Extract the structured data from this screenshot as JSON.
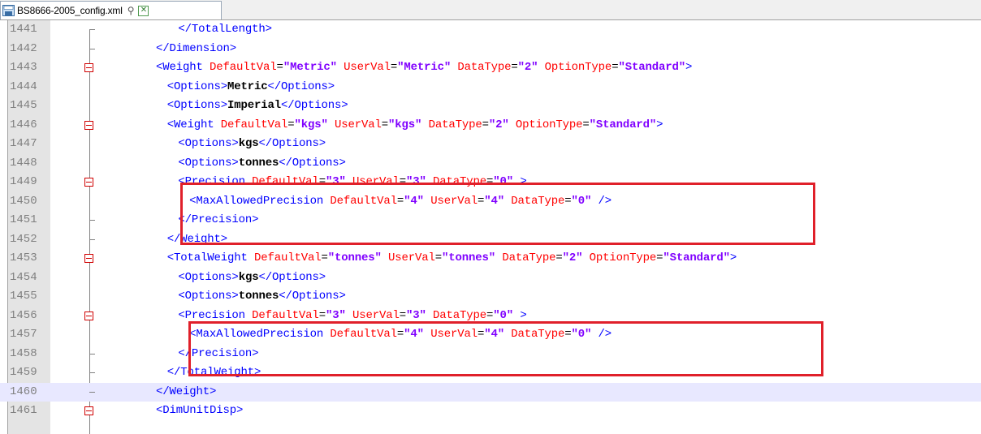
{
  "tab": {
    "filename": "BS8666-2005_config.xml",
    "pin_glyph": "⚲",
    "close_glyph": "✕",
    "icons": [
      "file-icon",
      "pin-icon",
      "close-icon"
    ]
  },
  "colors": {
    "tag": "#0000ff",
    "attribute_name": "#ff0000",
    "attribute_value": "#8000ff",
    "text": "#000000",
    "line_number": "#808080",
    "highlight_box": "#e0202a",
    "current_line": "#e8e8ff"
  },
  "lines": [
    {
      "num": "1441",
      "fold": "tick",
      "indent": 6,
      "segs": [
        {
          "t": "tb",
          "v": "</"
        },
        {
          "t": "tn",
          "v": "TotalLength"
        },
        {
          "t": "tb",
          "v": ">"
        }
      ]
    },
    {
      "num": "1442",
      "fold": "tick",
      "indent": 4,
      "segs": [
        {
          "t": "tb",
          "v": "</"
        },
        {
          "t": "tn",
          "v": "Dimension"
        },
        {
          "t": "tb",
          "v": ">"
        }
      ]
    },
    {
      "num": "1443",
      "fold": "box",
      "indent": 4,
      "segs": [
        {
          "t": "tb",
          "v": "<"
        },
        {
          "t": "tn",
          "v": "Weight"
        },
        {
          "t": "an",
          "v": " DefaultVal"
        },
        {
          "t": "eq",
          "v": "="
        },
        {
          "t": "av",
          "v": "\"Metric\""
        },
        {
          "t": "an",
          "v": " UserVal"
        },
        {
          "t": "eq",
          "v": "="
        },
        {
          "t": "av",
          "v": "\"Metric\""
        },
        {
          "t": "an",
          "v": " DataType"
        },
        {
          "t": "eq",
          "v": "="
        },
        {
          "t": "av",
          "v": "\"2\""
        },
        {
          "t": "an",
          "v": " OptionType"
        },
        {
          "t": "eq",
          "v": "="
        },
        {
          "t": "av",
          "v": "\"Standard\""
        },
        {
          "t": "tb",
          "v": ">"
        }
      ]
    },
    {
      "num": "1444",
      "fold": "none",
      "indent": 5,
      "segs": [
        {
          "t": "tb",
          "v": "<"
        },
        {
          "t": "tn",
          "v": "Options"
        },
        {
          "t": "tb",
          "v": ">"
        },
        {
          "t": "tx",
          "v": "Metric"
        },
        {
          "t": "tb",
          "v": "</"
        },
        {
          "t": "tn",
          "v": "Options"
        },
        {
          "t": "tb",
          "v": ">"
        }
      ]
    },
    {
      "num": "1445",
      "fold": "none",
      "indent": 5,
      "segs": [
        {
          "t": "tb",
          "v": "<"
        },
        {
          "t": "tn",
          "v": "Options"
        },
        {
          "t": "tb",
          "v": ">"
        },
        {
          "t": "tx",
          "v": "Imperial"
        },
        {
          "t": "tb",
          "v": "</"
        },
        {
          "t": "tn",
          "v": "Options"
        },
        {
          "t": "tb",
          "v": ">"
        }
      ]
    },
    {
      "num": "1446",
      "fold": "box",
      "indent": 5,
      "segs": [
        {
          "t": "tb",
          "v": "<"
        },
        {
          "t": "tn",
          "v": "Weight"
        },
        {
          "t": "an",
          "v": " DefaultVal"
        },
        {
          "t": "eq",
          "v": "="
        },
        {
          "t": "av",
          "v": "\"kgs\""
        },
        {
          "t": "an",
          "v": " UserVal"
        },
        {
          "t": "eq",
          "v": "="
        },
        {
          "t": "av",
          "v": "\"kgs\""
        },
        {
          "t": "an",
          "v": " DataType"
        },
        {
          "t": "eq",
          "v": "="
        },
        {
          "t": "av",
          "v": "\"2\""
        },
        {
          "t": "an",
          "v": " OptionType"
        },
        {
          "t": "eq",
          "v": "="
        },
        {
          "t": "av",
          "v": "\"Standard\""
        },
        {
          "t": "tb",
          "v": ">"
        }
      ]
    },
    {
      "num": "1447",
      "fold": "none",
      "indent": 6,
      "segs": [
        {
          "t": "tb",
          "v": "<"
        },
        {
          "t": "tn",
          "v": "Options"
        },
        {
          "t": "tb",
          "v": ">"
        },
        {
          "t": "tx",
          "v": "kgs"
        },
        {
          "t": "tb",
          "v": "</"
        },
        {
          "t": "tn",
          "v": "Options"
        },
        {
          "t": "tb",
          "v": ">"
        }
      ]
    },
    {
      "num": "1448",
      "fold": "none",
      "indent": 6,
      "segs": [
        {
          "t": "tb",
          "v": "<"
        },
        {
          "t": "tn",
          "v": "Options"
        },
        {
          "t": "tb",
          "v": ">"
        },
        {
          "t": "tx",
          "v": "tonnes"
        },
        {
          "t": "tb",
          "v": "</"
        },
        {
          "t": "tn",
          "v": "Options"
        },
        {
          "t": "tb",
          "v": ">"
        }
      ]
    },
    {
      "num": "1449",
      "fold": "box",
      "indent": 6,
      "segs": [
        {
          "t": "tb",
          "v": "<"
        },
        {
          "t": "tn",
          "v": "Precision"
        },
        {
          "t": "an",
          "v": " DefaultVal"
        },
        {
          "t": "eq",
          "v": "="
        },
        {
          "t": "av",
          "v": "\"3\""
        },
        {
          "t": "an",
          "v": " UserVal"
        },
        {
          "t": "eq",
          "v": "="
        },
        {
          "t": "av",
          "v": "\"3\""
        },
        {
          "t": "an",
          "v": " DataType"
        },
        {
          "t": "eq",
          "v": "="
        },
        {
          "t": "av",
          "v": "\"0\""
        },
        {
          "t": "tb",
          "v": " >"
        }
      ]
    },
    {
      "num": "1450",
      "fold": "none",
      "indent": 7,
      "segs": [
        {
          "t": "tb",
          "v": "<"
        },
        {
          "t": "tn",
          "v": "MaxAllowedPrecision"
        },
        {
          "t": "an",
          "v": " DefaultVal"
        },
        {
          "t": "eq",
          "v": "="
        },
        {
          "t": "av",
          "v": "\"4\""
        },
        {
          "t": "an",
          "v": " UserVal"
        },
        {
          "t": "eq",
          "v": "="
        },
        {
          "t": "av",
          "v": "\"4\""
        },
        {
          "t": "an",
          "v": " DataType"
        },
        {
          "t": "eq",
          "v": "="
        },
        {
          "t": "av",
          "v": "\"0\""
        },
        {
          "t": "tb",
          "v": " />"
        }
      ]
    },
    {
      "num": "1451",
      "fold": "tick",
      "indent": 6,
      "segs": [
        {
          "t": "tb",
          "v": "</"
        },
        {
          "t": "tn",
          "v": "Precision"
        },
        {
          "t": "tb",
          "v": ">"
        }
      ]
    },
    {
      "num": "1452",
      "fold": "tick",
      "indent": 5,
      "segs": [
        {
          "t": "tb",
          "v": "</"
        },
        {
          "t": "tn",
          "v": "Weight"
        },
        {
          "t": "tb",
          "v": ">"
        }
      ]
    },
    {
      "num": "1453",
      "fold": "box",
      "indent": 5,
      "segs": [
        {
          "t": "tb",
          "v": "<"
        },
        {
          "t": "tn",
          "v": "TotalWeight"
        },
        {
          "t": "an",
          "v": " DefaultVal"
        },
        {
          "t": "eq",
          "v": "="
        },
        {
          "t": "av",
          "v": "\"tonnes\""
        },
        {
          "t": "an",
          "v": " UserVal"
        },
        {
          "t": "eq",
          "v": "="
        },
        {
          "t": "av",
          "v": "\"tonnes\""
        },
        {
          "t": "an",
          "v": " DataType"
        },
        {
          "t": "eq",
          "v": "="
        },
        {
          "t": "av",
          "v": "\"2\""
        },
        {
          "t": "an",
          "v": " OptionType"
        },
        {
          "t": "eq",
          "v": "="
        },
        {
          "t": "av",
          "v": "\"Standard\""
        },
        {
          "t": "tb",
          "v": ">"
        }
      ]
    },
    {
      "num": "1454",
      "fold": "none",
      "indent": 6,
      "segs": [
        {
          "t": "tb",
          "v": "<"
        },
        {
          "t": "tn",
          "v": "Options"
        },
        {
          "t": "tb",
          "v": ">"
        },
        {
          "t": "tx",
          "v": "kgs"
        },
        {
          "t": "tb",
          "v": "</"
        },
        {
          "t": "tn",
          "v": "Options"
        },
        {
          "t": "tb",
          "v": ">"
        }
      ]
    },
    {
      "num": "1455",
      "fold": "none",
      "indent": 6,
      "segs": [
        {
          "t": "tb",
          "v": "<"
        },
        {
          "t": "tn",
          "v": "Options"
        },
        {
          "t": "tb",
          "v": ">"
        },
        {
          "t": "tx",
          "v": "tonnes"
        },
        {
          "t": "tb",
          "v": "</"
        },
        {
          "t": "tn",
          "v": "Options"
        },
        {
          "t": "tb",
          "v": ">"
        }
      ]
    },
    {
      "num": "1456",
      "fold": "box",
      "indent": 6,
      "segs": [
        {
          "t": "tb",
          "v": "<"
        },
        {
          "t": "tn",
          "v": "Precision"
        },
        {
          "t": "an",
          "v": " DefaultVal"
        },
        {
          "t": "eq",
          "v": "="
        },
        {
          "t": "av",
          "v": "\"3\""
        },
        {
          "t": "an",
          "v": " UserVal"
        },
        {
          "t": "eq",
          "v": "="
        },
        {
          "t": "av",
          "v": "\"3\""
        },
        {
          "t": "an",
          "v": " DataType"
        },
        {
          "t": "eq",
          "v": "="
        },
        {
          "t": "av",
          "v": "\"0\""
        },
        {
          "t": "tb",
          "v": " >"
        }
      ]
    },
    {
      "num": "1457",
      "fold": "none",
      "indent": 7,
      "segs": [
        {
          "t": "tb",
          "v": "<"
        },
        {
          "t": "tn",
          "v": "MaxAllowedPrecision"
        },
        {
          "t": "an",
          "v": " DefaultVal"
        },
        {
          "t": "eq",
          "v": "="
        },
        {
          "t": "av",
          "v": "\"4\""
        },
        {
          "t": "an",
          "v": " UserVal"
        },
        {
          "t": "eq",
          "v": "="
        },
        {
          "t": "av",
          "v": "\"4\""
        },
        {
          "t": "an",
          "v": " DataType"
        },
        {
          "t": "eq",
          "v": "="
        },
        {
          "t": "av",
          "v": "\"0\""
        },
        {
          "t": "tb",
          "v": " />"
        }
      ]
    },
    {
      "num": "1458",
      "fold": "tick",
      "indent": 6,
      "segs": [
        {
          "t": "tb",
          "v": "</"
        },
        {
          "t": "tn",
          "v": "Precision"
        },
        {
          "t": "tb",
          "v": ">"
        }
      ]
    },
    {
      "num": "1459",
      "fold": "tick",
      "indent": 5,
      "segs": [
        {
          "t": "tb",
          "v": "</"
        },
        {
          "t": "tn",
          "v": "TotalWeight"
        },
        {
          "t": "tb",
          "v": ">"
        }
      ]
    },
    {
      "num": "1460",
      "fold": "tick",
      "indent": 4,
      "current": true,
      "segs": [
        {
          "t": "tb",
          "v": "</"
        },
        {
          "t": "tn",
          "v": "Weight"
        },
        {
          "t": "tb",
          "v": ">"
        }
      ]
    },
    {
      "num": "1461",
      "fold": "box",
      "indent": 4,
      "segs": [
        {
          "t": "tb",
          "v": "<"
        },
        {
          "t": "tn",
          "v": "DimUnitDisp"
        },
        {
          "t": "tb",
          "v": ">"
        }
      ]
    }
  ]
}
